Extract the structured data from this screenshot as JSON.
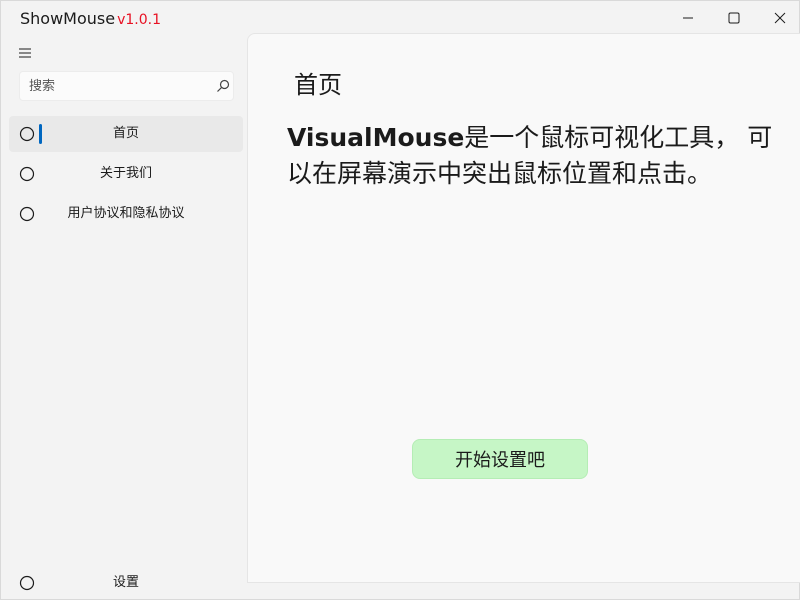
{
  "window": {
    "app_name": "ShowMouse",
    "version": "v1.0.1",
    "version_color": "#e81123",
    "controls": [
      "minimize-icon",
      "maximize-icon",
      "close-icon"
    ]
  },
  "sidebar": {
    "menu_icon": "hamburger-icon",
    "search": {
      "placeholder": "搜索",
      "value": "",
      "icon": "search-icon"
    },
    "items": [
      {
        "label": "首页",
        "icon": "circle-icon",
        "selected": true
      },
      {
        "label": "关于我们",
        "icon": "circle-icon",
        "selected": false
      },
      {
        "label": "用户协议和隐私协议",
        "icon": "circle-icon",
        "selected": false
      }
    ],
    "footer_item": {
      "label": "设置",
      "icon": "circle-icon"
    },
    "accent_color": "#0067c0"
  },
  "main": {
    "title": "首页",
    "headline_brand": "VisualMouse",
    "headline_rest": "是一个鼠标可视化工具， 可以在屏幕演示中突出鼠标位置和点击。",
    "start_button_label": "开始设置吧",
    "start_button_color": "#c6f6c6"
  }
}
